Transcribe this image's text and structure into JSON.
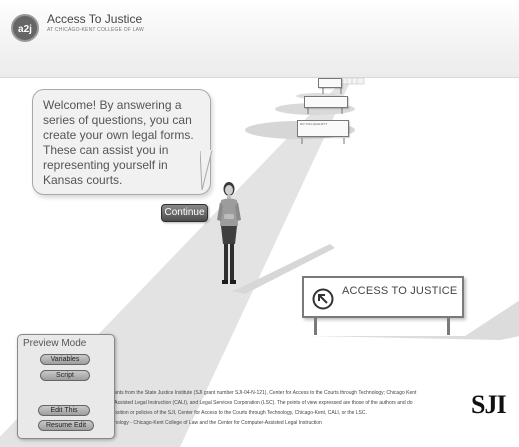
{
  "header": {
    "logo_text": "a2j",
    "title": "Access To Justice",
    "subtitle": "AT CHICAGO-KENT COLLEGE OF LAW"
  },
  "dialog": {
    "message": "Welcome!  By answering a series of questions, you can create your own legal forms. These can assist you in representing yourself in Kansas courts.",
    "continue_label": "Continue"
  },
  "sign": {
    "label": "ACCESS TO JUSTICE",
    "icon": "arrow-up-left-circle-icon"
  },
  "road_signs": {
    "third": "DO YOU QUALIFY?"
  },
  "credits": [
    "...ants from the State Justice Institute (SJI grant number SJI-04-N-121), Center for Access to the Courts through Technology; Chicago Kent",
    "...Assisted Legal Instruction (CALI), and Legal Services Corporation (LSC). The points of view expressed are those of the authors and do",
    "...osition or policies of the SJI, Center for Access to the Courts through Technology, Chicago-Kent, CALI, or the LSC.",
    "...nology - Chicago-Kent College of Law and the Center for Computer-Assisted Legal Instruction"
  ],
  "sji_logo": "SJI",
  "preview": {
    "title": "Preview Mode",
    "variables_label": "Variables",
    "script_label": "Script",
    "edit_this_label": "Edit This",
    "resume_edit_label": "Resume Edit"
  },
  "colors": {
    "road": "#e3e3e3",
    "shadow": "#d4d4d4",
    "button_dark": "#4c4c4c"
  }
}
